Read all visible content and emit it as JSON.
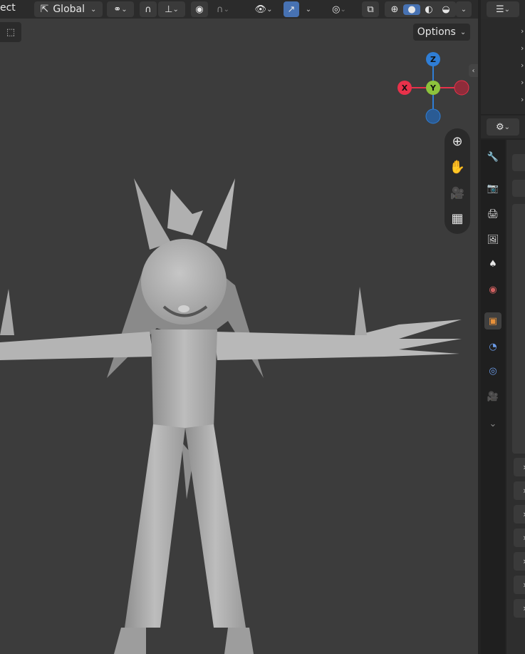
{
  "toolbar": {
    "mode_partial": "ect",
    "orientation": "Global",
    "options_label": "Options"
  },
  "gizmo": {
    "z": "Z",
    "y": "Y",
    "x": "X"
  },
  "colors": {
    "x_axis": "#e8314a",
    "y_axis": "#8dc33c",
    "z_axis": "#2f7ed6",
    "accent": "#4772b3",
    "viewport_bg": "#3c3c3c",
    "object_tab": "#e8913a"
  },
  "nav_icons": [
    "zoom-icon",
    "pan-hand-icon",
    "camera-view-icon",
    "grid-view-icon"
  ],
  "property_tabs": [
    "tool-icon",
    "render-icon",
    "output-icon",
    "view-layer-icon",
    "scene-icon",
    "world-icon",
    "object-icon",
    "modifier-icon",
    "particles-icon",
    "physics-icon",
    "more-icon"
  ]
}
